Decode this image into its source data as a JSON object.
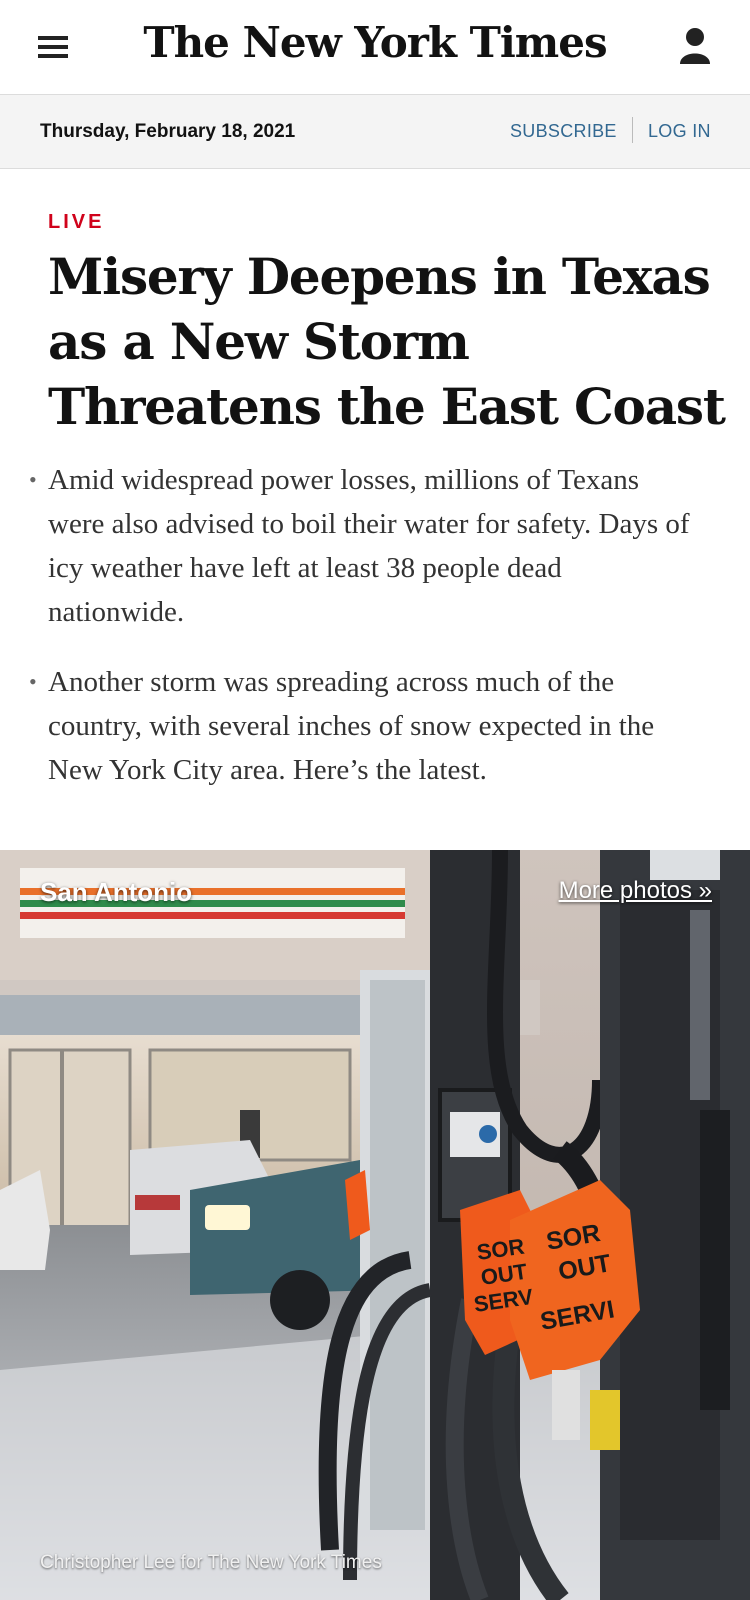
{
  "header": {
    "masthead": "The New York Times",
    "menu_icon": "hamburger-menu-icon",
    "account_icon": "account-user-icon"
  },
  "datebar": {
    "date": "Thursday, February 18, 2021",
    "subscribe_label": "SUBSCRIBE",
    "login_label": "LOG IN"
  },
  "article": {
    "live_label": "LIVE",
    "headline": "Misery Deepens in Texas as a New Storm Threatens the East Coast",
    "bullets": [
      "Amid widespread power losses, millions of Texans were also advised to boil their water for safety. Days of icy weather have left at least 38 people dead nationwide.",
      "Another storm was spreading across much of the country, with several inches of snow expected in the New York City area. Here’s the latest."
    ]
  },
  "photo": {
    "location": "San Antonio",
    "more_photos_label": "More photos »",
    "credit": "Christopher Lee for The New York Times"
  },
  "colors": {
    "live_red": "#d0021b",
    "link_blue": "#326891",
    "bag_orange": "#ef5a1c"
  }
}
